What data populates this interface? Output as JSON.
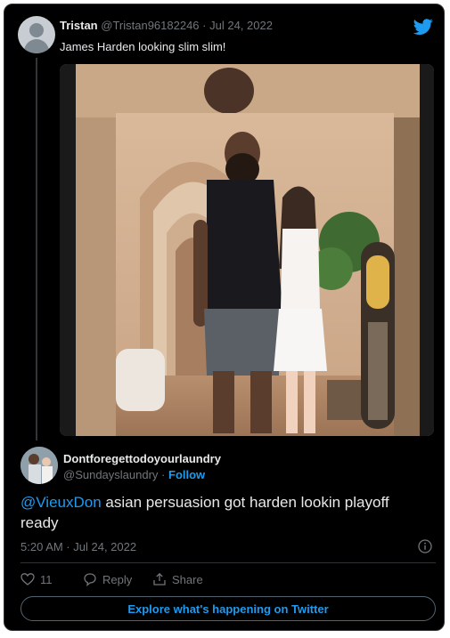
{
  "quoted_tweet": {
    "name": "Tristan",
    "handle": "@Tristan96182246",
    "separator": " · ",
    "date": "Jul 24, 2022",
    "text": "James Harden looking slim slim!"
  },
  "reply_tweet": {
    "name": "Dontforegettodoyourlaundry",
    "handle": "@Sundayslaundry",
    "separator": " · ",
    "follow_label": "Follow",
    "mention": "@VieuxDon",
    "text": " asian persuasion got harden lookin playoff ready",
    "timestamp": "5:20 AM · Jul 24, 2022"
  },
  "actions": {
    "like_count": "11",
    "reply_label": "Reply",
    "share_label": "Share"
  },
  "explore_label": "Explore what's happening on Twitter",
  "colors": {
    "background": "#000000",
    "accent": "#1d9bf0",
    "secondary_text": "#71767b",
    "border": "#2f3336"
  },
  "icons": [
    "default-avatar-icon",
    "twitter-bird-icon",
    "info-icon",
    "heart-icon",
    "reply-bubble-icon",
    "share-icon"
  ]
}
